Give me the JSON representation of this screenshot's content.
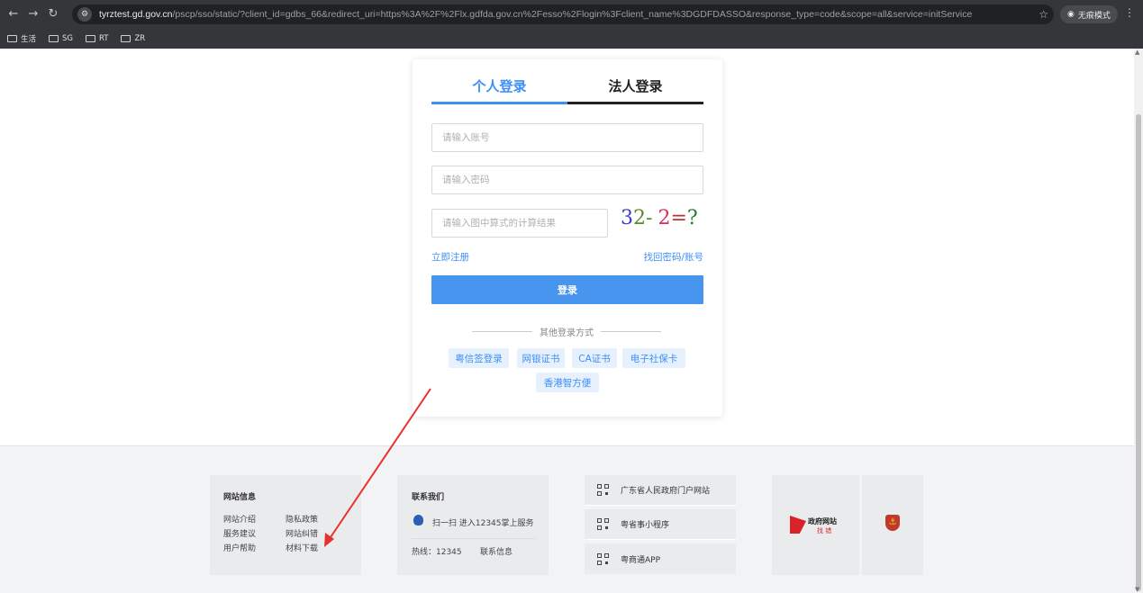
{
  "browser": {
    "url_host": "tyrztest.gd.gov.cn",
    "url_rest": "/pscp/sso/static/?client_id=gdbs_66&redirect_uri=https%3A%2F%2Flx.gdfda.gov.cn%2Fesso%2Flogin%3Fclient_name%3DGDFDASSO&response_type=code&scope=all&service=initService",
    "incognito_label": "无痕模式",
    "bookmarks": [
      "生活",
      "SG",
      "RT",
      "ZR"
    ]
  },
  "login": {
    "tab_personal": "个人登录",
    "tab_legal": "法人登录",
    "account_placeholder": "请输入账号",
    "password_placeholder": "请输入密码",
    "captcha_placeholder": "请输入图中算式的计算结果",
    "captcha": [
      "3",
      "2-",
      "2",
      "=",
      "?"
    ],
    "register_link": "立即注册",
    "recover_link": "找回密码/账号",
    "login_button": "登录",
    "other_methods": "其他登录方式",
    "alt_methods": [
      "粤信签登录",
      "网银证书",
      "CA证书",
      "电子社保卡",
      "香港智方便"
    ]
  },
  "footer": {
    "site_info": {
      "title": "网站信息",
      "items": [
        "网站介绍",
        "隐私政策",
        "服务建议",
        "网站纠错",
        "用户帮助",
        "材料下载"
      ]
    },
    "contact": {
      "title": "联系我们",
      "scan_text": "扫一扫 进入12345掌上服务",
      "hotline": "热线：12345",
      "contact_info": "联系信息"
    },
    "links": [
      "广东省人民政府门户网站",
      "粤省事小程序",
      "粤商通APP"
    ],
    "badge_gov": "政府网站",
    "badge_gov_sub": "找 错"
  },
  "colors": {
    "accent": "#3e8ef7",
    "arrow": "#e8312f"
  }
}
